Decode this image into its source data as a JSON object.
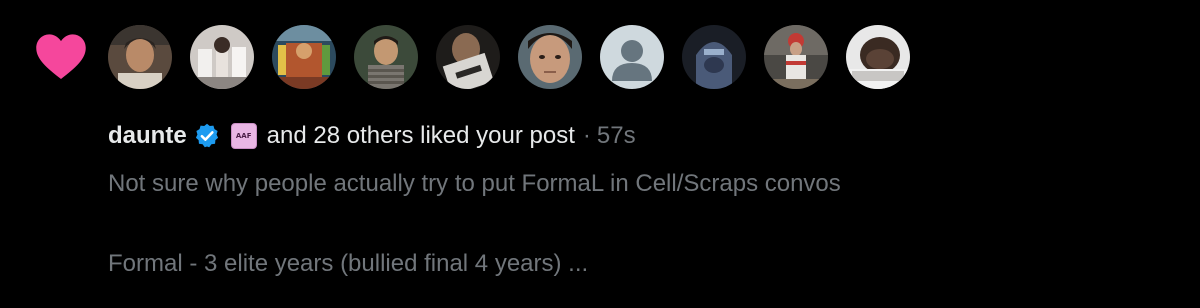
{
  "notification": {
    "type": "like",
    "icon": "heart-icon",
    "accent_color": "#f5479c",
    "avatars": [
      {
        "name": "avatar-1"
      },
      {
        "name": "avatar-2"
      },
      {
        "name": "avatar-3"
      },
      {
        "name": "avatar-4"
      },
      {
        "name": "avatar-5"
      },
      {
        "name": "avatar-6"
      },
      {
        "name": "avatar-7-default"
      },
      {
        "name": "avatar-8"
      },
      {
        "name": "avatar-9"
      },
      {
        "name": "avatar-10"
      }
    ],
    "username": "daunte",
    "verified_color": "#1d9bf0",
    "badge_text": "AAF",
    "liked_text": "and 28 others liked your post",
    "separator": "·",
    "timestamp": "57s",
    "post_preview": {
      "line1": "Not sure why people actually try to put FormaL in Cell/Scraps convos",
      "line2": "Formal - 3 elite years (bullied final 4 years) ..."
    }
  }
}
